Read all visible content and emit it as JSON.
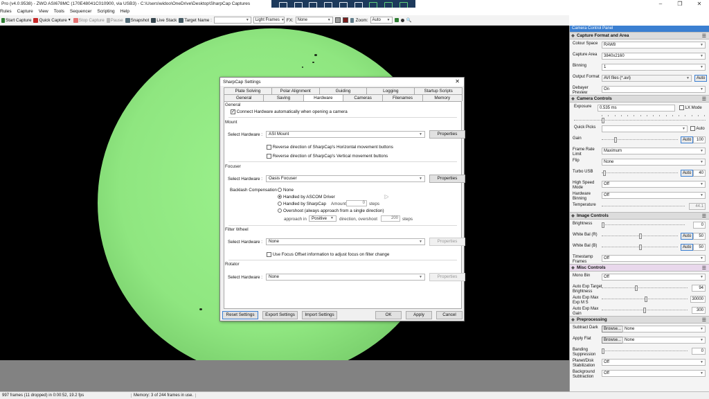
{
  "window": {
    "title": "Pro (v4.0.9538) - ZWO ASI678MC (170E48041C010900, via USB3) - C:\\Users\\widoo\\OneDrive\\Desktop\\SharpCap Captures",
    "minimize": "–",
    "maximize": "❐",
    "close": "✕"
  },
  "menu": [
    "Rules",
    "Capture",
    "View",
    "Tools",
    "Sequencer",
    "Scripting",
    "Help"
  ],
  "toolbar": {
    "start_capture": "Start Capture",
    "quick_capture": "Quick Capture",
    "stop_capture": "Stop Capture",
    "pause": "Pause",
    "snapshot": "Snapshot",
    "live_stack": "Live Stack",
    "target_name_label": "Target Name :",
    "target_name_value": "",
    "frame_type": "Light Frames",
    "fx_label": "FX:",
    "fx_value": "None",
    "zoom_label": "Zoom:",
    "zoom_value": "Auto"
  },
  "status": {
    "frames": "997 frames (11 dropped) in 0:00:52, 19.2 fps",
    "memory": "Memory: 3 of 244 frames in use."
  },
  "panel": {
    "title": "Camera Control Panel",
    "capture_format": {
      "header": "Capture Format and Area",
      "colour_space_label": "Colour Space",
      "colour_space": "RAW8",
      "capture_area_label": "Capture Area",
      "capture_area": "3840x2160",
      "binning_label": "Binning",
      "binning": "1",
      "output_format_label": "Output Format",
      "output_format": "AVI files (*.avi)",
      "auto": "Auto",
      "debayer_label": "Debayer Preview",
      "debayer": "On"
    },
    "camera_controls": {
      "header": "Camera Controls",
      "exposure_label": "Exposure",
      "exposure": "0.535 ms",
      "lx_mode": "LX Mode",
      "quick_picks_label": "Quick Picks",
      "auto": "Auto",
      "gain_label": "Gain",
      "gain_auto": "Auto",
      "gain": "100",
      "frame_rate_label": "Frame Rate Limit",
      "frame_rate": "Maximum",
      "flip_label": "Flip",
      "flip": "None",
      "turbo_label": "Turbo USB",
      "turbo_auto": "Auto",
      "turbo": "40",
      "high_speed_label": "High Speed Mode",
      "high_speed": "Off",
      "hw_binning_label": "Hardware Binning",
      "hw_binning": "Off",
      "temperature_label": "Temperature",
      "temperature": "44.1"
    },
    "image_controls": {
      "header": "Image Controls",
      "brightness_label": "Brightness",
      "brightness": "0",
      "wb_r_label": "White Bal (R)",
      "wb_r_auto": "Auto",
      "wb_r": "50",
      "wb_b_label": "White Bal (B)",
      "wb_b_auto": "Auto",
      "wb_b": "50",
      "timestamp_label": "Timestamp Frames",
      "timestamp": "Off"
    },
    "misc_controls": {
      "header": "Misc Controls",
      "mono_bin_label": "Mono Bin",
      "mono_bin": "Off",
      "target_bright_label": "Auto Exp Target Brightness",
      "target_bright": "94",
      "max_exp_label": "Auto Exp Max Exp M S",
      "max_exp": "30000",
      "max_gain_label": "Auto Exp Max Gain",
      "max_gain": "300"
    },
    "preprocessing": {
      "header": "Preprocessing",
      "subtract_dark_label": "Subtract Dark",
      "browse": "Browse...",
      "subtract_dark": "None",
      "apply_flat_label": "Apply Flat",
      "apply_flat": "None",
      "banding_label": "Banding Suppression",
      "banding": "0",
      "stabilization_label": "Planet/Disk Stabilization",
      "stabilization": "Off",
      "background_label": "Background Subtraction",
      "background": "Off"
    }
  },
  "dialog": {
    "title": "SharpCap Settings",
    "close": "✕",
    "tabs_row1": [
      "Plate Solving",
      "Polar Alignment",
      "Guiding",
      "Logging",
      "Startup Scripts"
    ],
    "tabs_row2": [
      "General",
      "Saving",
      "Hardware",
      "Cameras",
      "Filenames",
      "Memory"
    ],
    "active_tab": "Hardware",
    "general_group": "General",
    "connect_auto": "Connect Hardware automatically when opening a camera",
    "mount_group": "Mount",
    "select_hardware": "Select Hardware :",
    "mount_value": "ASI Mount",
    "properties": "Properties",
    "reverse_h": "Reverse direction of SharpCap's Horizontal movement buttons",
    "reverse_v": "Reverse direction of SharpCap's Vertical movement buttons",
    "focuser_group": "Focuser",
    "focuser_value": "Oasis Focuser",
    "backlash_label": "Backlash Compensation :",
    "bl_none": "None",
    "bl_ascom": "Handled by ASCOM Driver",
    "bl_sharpcap": "Handled by SharpCap",
    "amount_label": "Amount",
    "amount_value": "0",
    "steps": "steps",
    "bl_overshoot": "Overshoot (always approach from a single direction)",
    "approach_in": "approach in",
    "approach_value": "Positive",
    "direction_overshoot": "direction, overshoot",
    "overshoot_value": "200",
    "filter_group": "Filter Wheel",
    "filter_value": "None",
    "focus_offset": "Use Focus Offset information to adjust focus on filter change",
    "rotator_group": "Rotator",
    "rotator_value": "None",
    "reset": "Reset Settings",
    "export": "Export Settings",
    "import": "Import Settings",
    "ok": "OK",
    "apply": "Apply",
    "cancel": "Cancel"
  }
}
